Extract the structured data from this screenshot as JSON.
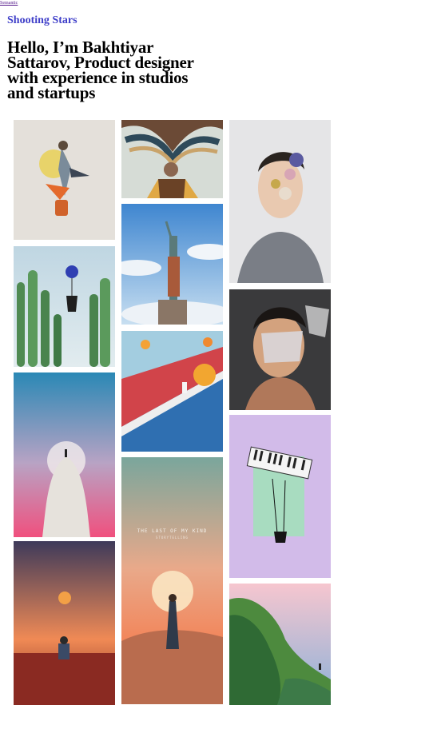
{
  "skip_link": "Semantic",
  "site_title": "Shooting Stars",
  "intro": "Hello, I’m Bakhtiyar Sattarov, Product designer with experience in studios and startups",
  "gallery": {
    "columns": [
      [
        {
          "name": "photo-dancer-collage"
        },
        {
          "name": "photo-cactus-balloon"
        },
        {
          "name": "photo-ghost-figure"
        },
        {
          "name": "photo-sunset-field"
        }
      ],
      [
        {
          "name": "photo-tree-head-collage"
        },
        {
          "name": "photo-statue-of-liberty"
        },
        {
          "name": "photo-red-track-child"
        },
        {
          "name": "photo-desert-woman",
          "caption": "THE LAST OF MY KIND",
          "subcaption": "STORYTELLING"
        }
      ],
      [
        {
          "name": "photo-man-flowers-face"
        },
        {
          "name": "photo-man-mask-graffiti"
        },
        {
          "name": "photo-piano-swing"
        },
        {
          "name": "photo-floating-island"
        }
      ]
    ]
  },
  "colors": {
    "title_link": "#3f3fc9",
    "skip_link": "#551a8b"
  }
}
